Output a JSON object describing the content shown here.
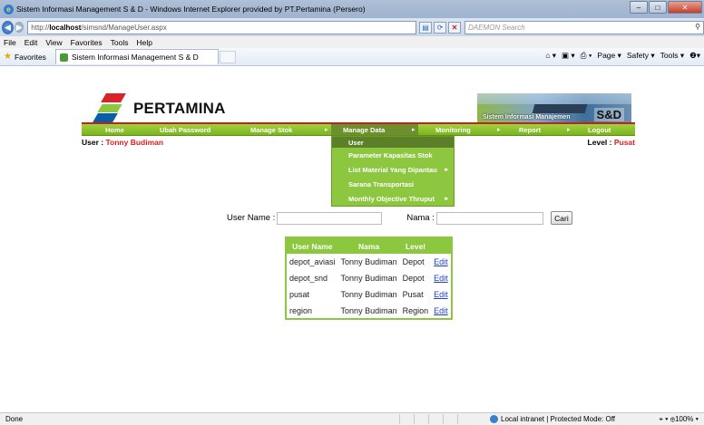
{
  "window": {
    "title": "Sistem Informasi Management S & D - Windows Internet Explorer provided by PT.Pertamina (Persero)",
    "min": "–",
    "max": "□",
    "close": "✕"
  },
  "address": {
    "url_prefix": "http://",
    "url_host": "localhost",
    "url_path": "/simsnd/ManageUser.aspx",
    "search_placeholder": "DAEMON Search"
  },
  "menubar": [
    "File",
    "Edit",
    "View",
    "Favorites",
    "Tools",
    "Help"
  ],
  "favbar": {
    "favorites": "Favorites",
    "tab_title": "Sistem Informasi Management S & D"
  },
  "commandbar": [
    "Page ▾",
    "Safety ▾",
    "Tools ▾",
    "❷▾"
  ],
  "logo": {
    "text": "PERTAMINA"
  },
  "banner": {
    "text": "Sistem Informasi Manajemen",
    "sd": "S&D"
  },
  "nav": {
    "items": [
      "Home",
      "Ubah Password",
      "Manage Stok",
      "Manage Data",
      "Monitoring",
      "Report",
      "Logout"
    ],
    "arrow": "▸"
  },
  "user": {
    "label": "User : ",
    "name": "Tonny Budiman",
    "level_label": "Level : ",
    "level": "Pusat"
  },
  "dropdown": {
    "items": [
      {
        "label": "User",
        "submenu": false
      },
      {
        "label": "Parameter Kapasitas Stok",
        "submenu": false
      },
      {
        "label": "List Material Yang Dipantau",
        "submenu": true
      },
      {
        "label": "Sarana Transportasi",
        "submenu": false
      },
      {
        "label": "Monthly Objective Thruput",
        "submenu": true
      }
    ]
  },
  "search": {
    "username_label": "User Name :",
    "nama_label": "Nama :",
    "username_value": "",
    "nama_value": "",
    "button": "Cari"
  },
  "table": {
    "headers": [
      "User Name",
      "Nama",
      "Level",
      ""
    ],
    "rows": [
      [
        "depot_aviasi",
        "Tonny Budiman",
        "Depot",
        "Edit"
      ],
      [
        "depot_snd",
        "Tonny Budiman",
        "Depot",
        "Edit"
      ],
      [
        "pusat",
        "Tonny Budiman",
        "Pusat",
        "Edit"
      ],
      [
        "region",
        "Tonny Budiman",
        "Region",
        "Edit"
      ]
    ]
  },
  "status": {
    "left": "Done",
    "zone": "Local intranet | Protected Mode: Off",
    "zoom": "⌖ ▾  ⊕100% ▾"
  },
  "colors": {
    "nav_green": "#8dc63f",
    "red_accent": "#cc1d1d",
    "user_name": "#d82020"
  }
}
